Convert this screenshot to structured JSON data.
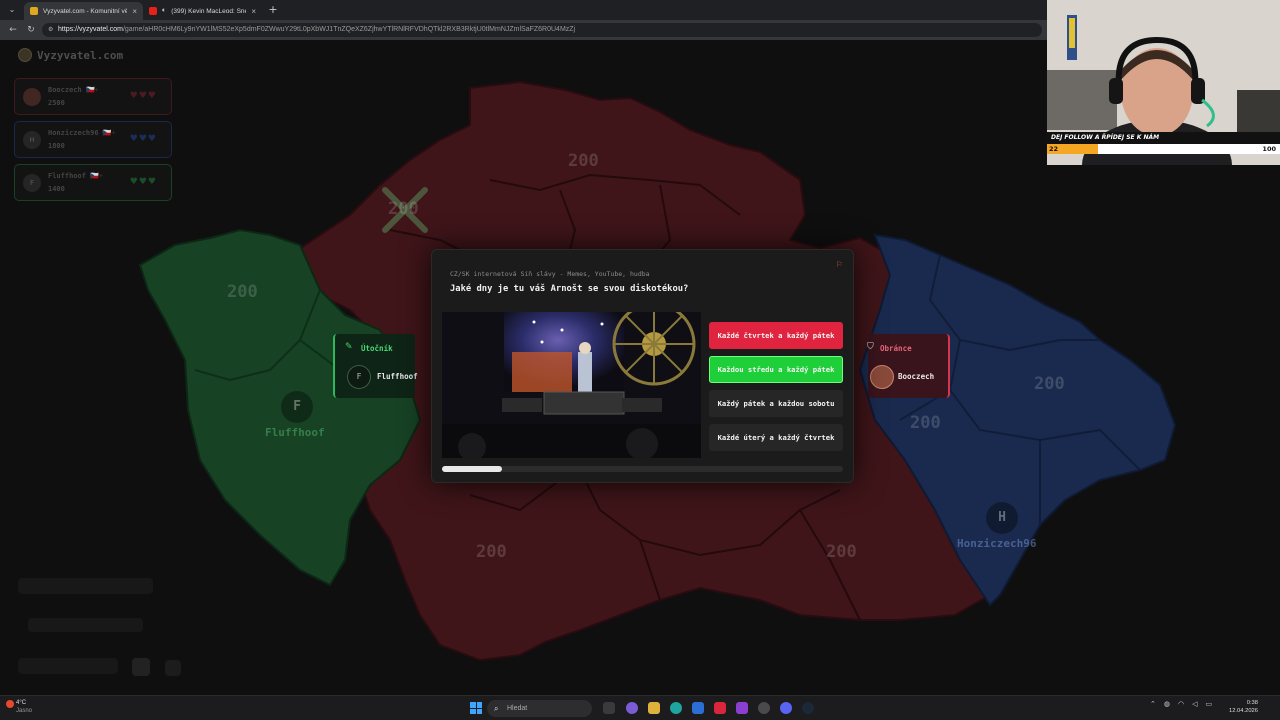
{
  "browser": {
    "tabs": [
      {
        "title": "Vyzyvatel.com - Komunitní vědo...",
        "active": true,
        "favicon_color": "#e0a81c"
      },
      {
        "title": "(399) Kevin MacLeod: Sneaky",
        "active": false,
        "favicon_color": "#e62117"
      }
    ],
    "url_host": "https://vyzyvatel.com",
    "url_path": "/game/aHR0cHM6Ly9nYW1lMS52eXp5dmF0ZWwuY29tL0pXbWJ1TnZQeXZ6ZjhwYTlRNlRFVDhQTkl2RXB3RktjU0tlMmNJZmlSaFZ6R0U4MzZj"
  },
  "app": {
    "logo": "Vyzyvatel.com"
  },
  "players": [
    {
      "name": "Booczech",
      "flag": "🇨🇿+",
      "score": "2500",
      "initial": "",
      "color": "#c8303d",
      "hearts": "♥♥♥"
    },
    {
      "name": "Honziczech96",
      "flag": "🇨🇿+",
      "score": "1800",
      "initial": "H",
      "color": "#2f5fbf",
      "hearts": "♥♥♥"
    },
    {
      "name": "Fluffhoof",
      "flag": "🇨🇿+",
      "score": "1400",
      "initial": "F",
      "color": "#2fa854",
      "hearts": "♥♥♥"
    }
  ],
  "map": {
    "region_scores": [
      "200",
      "200",
      "200",
      "200",
      "200",
      "200",
      "200"
    ],
    "bases": {
      "green": {
        "initial": "F",
        "name": "Fluffhoof"
      },
      "blue": {
        "initial": "H",
        "name": "Honziczech96"
      }
    }
  },
  "attacker": {
    "role": "Útočník",
    "name": "Fluffhoof",
    "initial": "F"
  },
  "defender": {
    "role": "Obránce",
    "name": "Booczech"
  },
  "question": {
    "category": "CZ/SK internetová Síň slávy - Memes, YouTube, hudba",
    "text": "Jaké dny je tu váš Arnošt se svou diskotékou?",
    "answers": [
      {
        "label": "Každé čtvrtek a každý pátek",
        "state": "wrong",
        "color": "#e0243f"
      },
      {
        "label": "Každou středu a každý pátek",
        "state": "correct",
        "color": "#1fcf3a"
      },
      {
        "label": "Každý pátek a každou sobotu",
        "state": "neutral",
        "color": "#262627"
      },
      {
        "label": "Každé úterý a každý čtvrtek",
        "state": "neutral",
        "color": "#262627"
      }
    ],
    "timer_fraction": 0.15
  },
  "stream_overlay": {
    "banner": "DEJ FOLLOW A ŘPÍDEJ SE K NÁM",
    "progress_current": "22",
    "progress_goal": "100",
    "progress_fraction": 0.22
  },
  "taskbar": {
    "weather_temp": "4°C",
    "weather_desc": "Jasno",
    "search_placeholder": "Hledat",
    "time": "0:38",
    "date": "12.04.2026"
  }
}
